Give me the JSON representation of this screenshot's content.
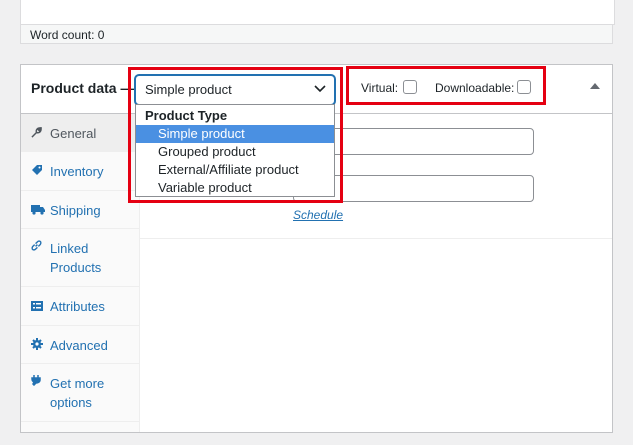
{
  "editor": {
    "word_count": "Word count: 0"
  },
  "product_data": {
    "title": "Product data —",
    "type_select": {
      "value": "Simple product"
    },
    "dropdown": {
      "group": "Product Type",
      "options": [
        "Simple product",
        "Grouped product",
        "External/Affiliate product",
        "Variable product"
      ],
      "selected": "Simple product"
    },
    "virtual_label": "Virtual:",
    "downloadable_label": "Downloadable:",
    "virtual_checked": false,
    "downloadable_checked": false,
    "schedule_link": "Schedule",
    "tabs": [
      {
        "label": "General",
        "icon": "wrench-icon"
      },
      {
        "label": "Inventory",
        "icon": "tag-icon"
      },
      {
        "label": "Shipping",
        "icon": "truck-icon"
      },
      {
        "label": "Linked Products",
        "icon": "link-icon"
      },
      {
        "label": "Attributes",
        "icon": "list-icon"
      },
      {
        "label": "Advanced",
        "icon": "gear-icon"
      },
      {
        "label": "Get more options",
        "icon": "plugin-icon"
      }
    ]
  },
  "colors": {
    "highlight": "#e50012",
    "accent": "#2271b1",
    "selected_option": "#4a90e2"
  }
}
